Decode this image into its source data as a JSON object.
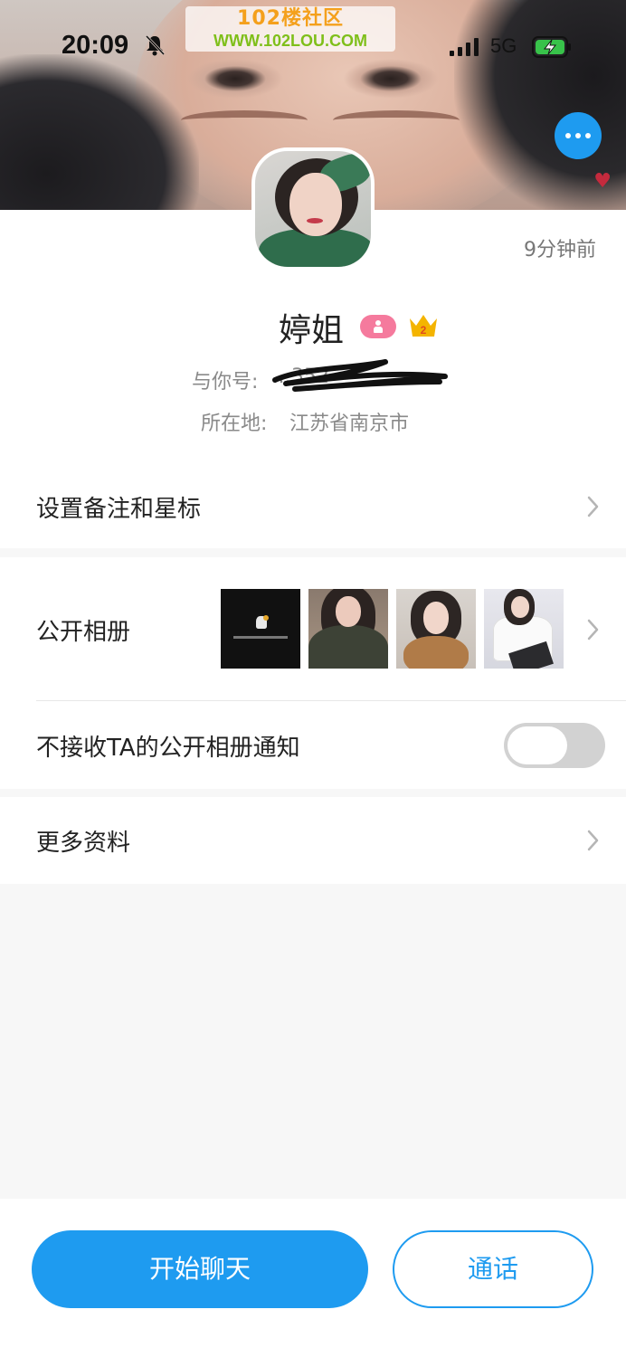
{
  "status_bar": {
    "time": "20:09",
    "network": "5G"
  },
  "watermark": {
    "title": "102楼社区",
    "url": "WWW.102LOU.COM"
  },
  "profile": {
    "last_seen": "9分钟前",
    "name": "婷姐",
    "vip_level": "2",
    "account_label": "与你号:",
    "account_value": "…352",
    "location_label": "所在地:",
    "location_value": "江苏省南京市"
  },
  "menu": {
    "remark_label": "设置备注和星标",
    "album_label": "公开相册",
    "notify_label": "不接收TA的公开相册通知",
    "notify_enabled": false,
    "more_info_label": "更多资料"
  },
  "actions": {
    "chat_label": "开始聊天",
    "call_label": "通话"
  },
  "colors": {
    "accent": "#1e9bf0",
    "gender_badge": "#f57a9d",
    "crown": "#f4b400"
  },
  "icons": [
    "bell-muted-icon",
    "signal-icon",
    "battery-charging-icon",
    "more-dots-icon",
    "gender-icon",
    "crown-icon",
    "chevron-right-icon"
  ]
}
